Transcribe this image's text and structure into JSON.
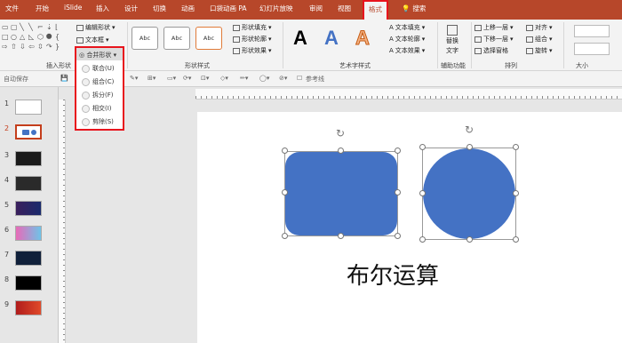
{
  "tabs": [
    {
      "label": "文件",
      "x_hint": "file"
    },
    {
      "label": "开始"
    },
    {
      "label": "iSlide"
    },
    {
      "label": "插入"
    },
    {
      "label": "设计"
    },
    {
      "label": "切换"
    },
    {
      "label": "动画"
    },
    {
      "label": "口袋动画 PA"
    },
    {
      "label": "幻灯片放映"
    },
    {
      "label": "审阅"
    },
    {
      "label": "视图"
    },
    {
      "label": "格式"
    },
    {
      "label": "搜索"
    }
  ],
  "ribbon": {
    "insert_shapes": {
      "edit_shape": "编辑形状",
      "text_box": "文本框",
      "merge_shapes": "合并形状",
      "group_label": "插入形状"
    },
    "shape_styles": {
      "abc": "Abc",
      "fill": "形状填充",
      "outline": "形状轮廓",
      "effects": "形状效果",
      "group_label": "形状样式"
    },
    "wordart": {
      "glyph": "A",
      "text_fill": "文本填充",
      "text_outline": "文本轮廓",
      "text_effects": "文本效果",
      "group_label": "艺术字样式"
    },
    "aux": {
      "replace_text": "替换",
      "replace_text_2": "文字",
      "group_label": "辅助功能"
    },
    "arrange": {
      "bring_forward": "上移一层",
      "send_backward": "下移一层",
      "selection_pane": "选择窗格",
      "align": "对齐",
      "group": "组合",
      "rotate": "旋转",
      "group_label": "排列"
    },
    "size": {
      "group_label": "大小"
    }
  },
  "subbar": {
    "autosave": "自动保存",
    "guides": "参考线"
  },
  "merge_menu": {
    "header": "合并形状",
    "items": [
      "联合(U)",
      "组合(C)",
      "拆分(F)",
      "相交(I)",
      "剪除(S)"
    ]
  },
  "slides": [
    "1",
    "2",
    "3",
    "4",
    "5",
    "6",
    "7",
    "8",
    "9"
  ],
  "active_slide": "2",
  "slide": {
    "title": "布尔运算",
    "shape_color": "#4472c4"
  },
  "colors": {
    "accent": "#b7472a",
    "highlight_border": "#e8141d"
  }
}
